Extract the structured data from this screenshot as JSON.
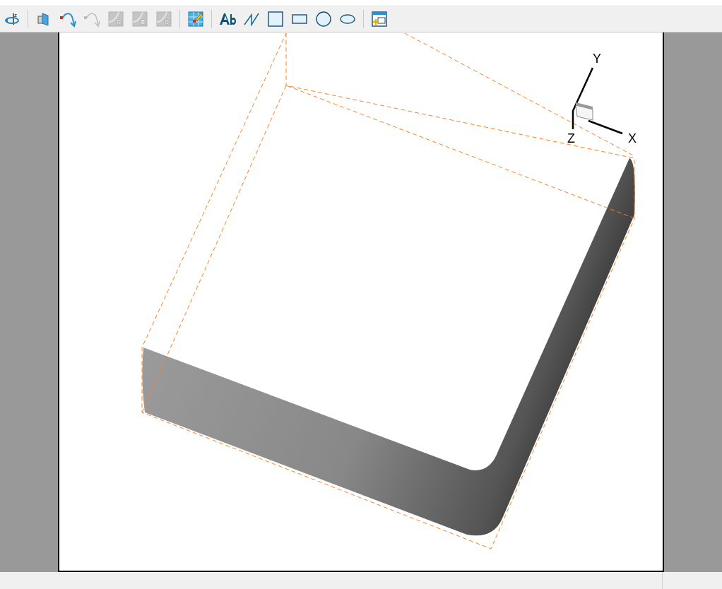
{
  "toolbar": {
    "groups": [
      {
        "items": [
          {
            "kind": "rotate",
            "disabled": false,
            "glyph": "z"
          }
        ]
      },
      {
        "items": [
          {
            "kind": "slice",
            "disabled": false
          },
          {
            "kind": "undo",
            "disabled": false
          },
          {
            "kind": "redo",
            "disabled": true
          },
          {
            "kind": "zoom-in",
            "disabled": true
          },
          {
            "kind": "zoom-out",
            "disabled": true
          },
          {
            "kind": "zoom-value",
            "disabled": true
          }
        ]
      },
      {
        "items": [
          {
            "kind": "probe",
            "disabled": false
          }
        ]
      },
      {
        "items": [
          {
            "kind": "text",
            "disabled": false
          },
          {
            "kind": "line",
            "disabled": false
          },
          {
            "kind": "square",
            "disabled": false
          },
          {
            "kind": "rectangle",
            "disabled": false
          },
          {
            "kind": "circle",
            "disabled": false
          },
          {
            "kind": "ellipse",
            "disabled": false
          }
        ]
      },
      {
        "items": [
          {
            "kind": "add-frame",
            "disabled": false
          }
        ]
      }
    ]
  },
  "axes": {
    "x_label": "X",
    "y_label": "Y",
    "z_label": "Z"
  }
}
